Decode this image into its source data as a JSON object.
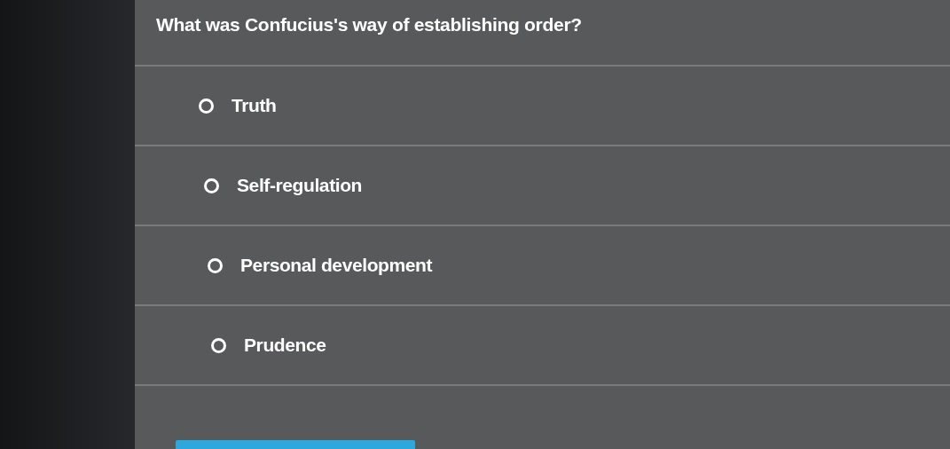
{
  "question": "What was Confucius's way of establishing order?",
  "options": [
    {
      "label": "Truth",
      "selected": false
    },
    {
      "label": "Self-regulation",
      "selected": false
    },
    {
      "label": "Personal development",
      "selected": false
    },
    {
      "label": "Prudence",
      "selected": false
    }
  ]
}
